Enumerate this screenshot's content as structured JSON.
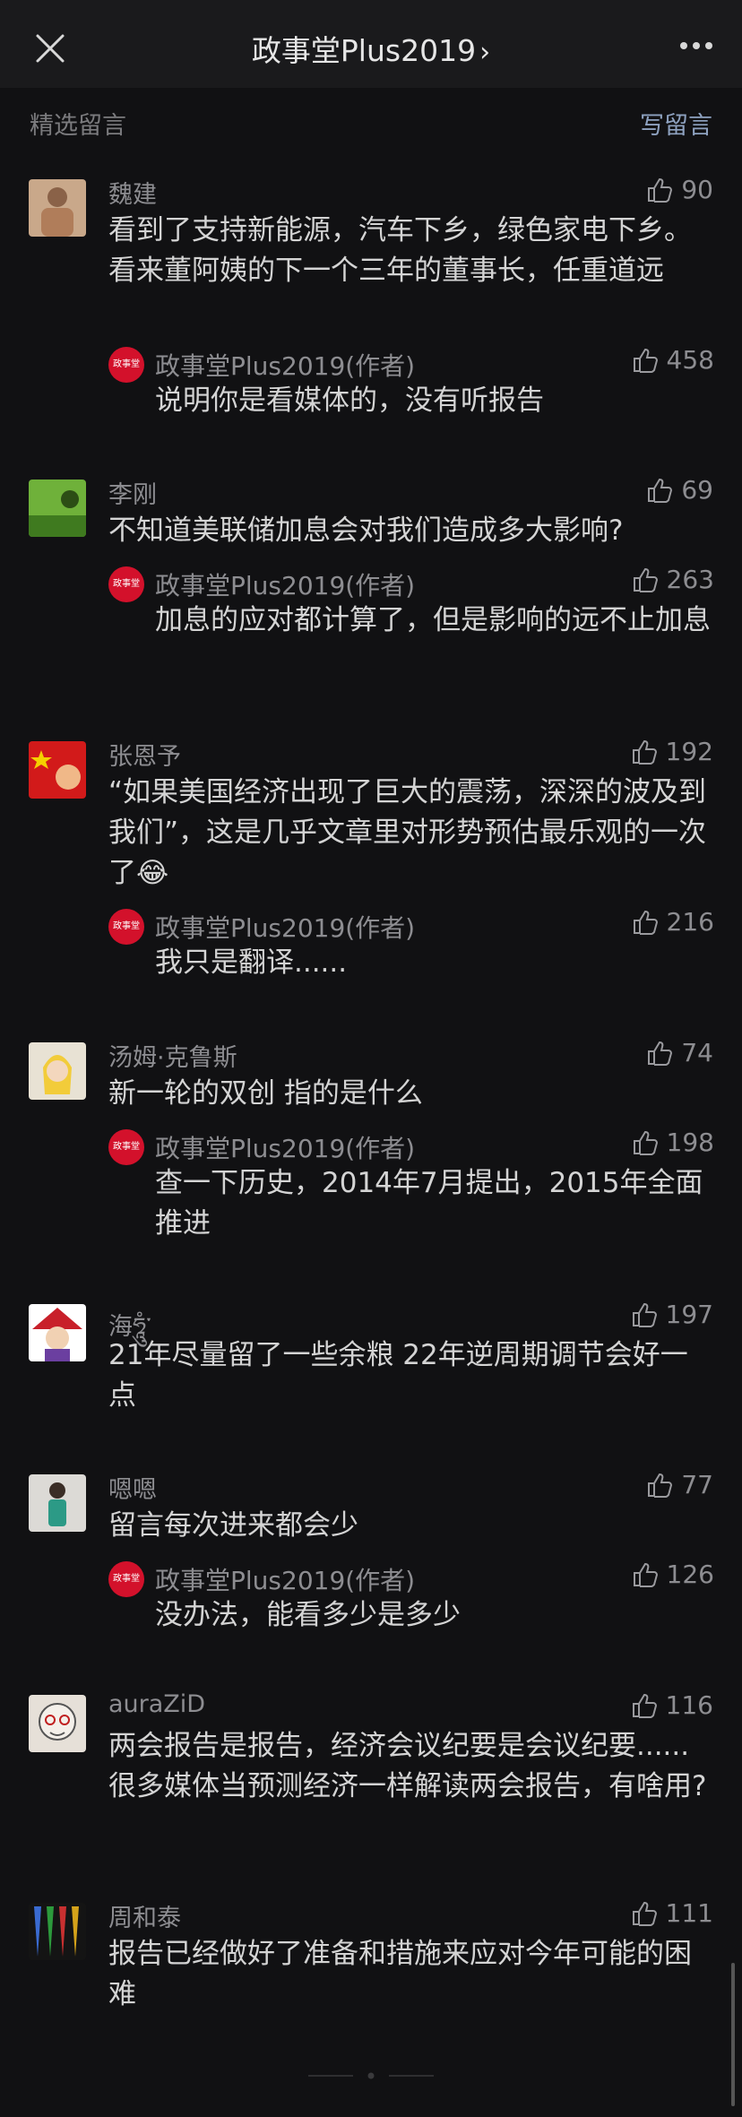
{
  "header": {
    "title": "政事堂Plus2019",
    "chevron": "›",
    "close_icon": "close-icon",
    "more_icon": "more-icon"
  },
  "section": {
    "title": "精选留言",
    "write_label": "写留言"
  },
  "colors": {
    "background": "#111113",
    "topbar": "#1a1a1c",
    "accent_link": "#8ea2c0",
    "author_badge": "#d3112b"
  },
  "comments": [
    {
      "nickname": "魏建",
      "likes": "90",
      "text": "看到了支持新能源，汽车下乡，绿色家电下乡。看来董阿姨的下一个三年的董事长，任重道远",
      "reply": {
        "name": "政事堂Plus2019(作者)",
        "likes": "458",
        "text": "说明你是看媒体的，没有听报告"
      }
    },
    {
      "nickname": "李刚",
      "likes": "69",
      "text": "不知道美联储加息会对我们造成多大影响?",
      "reply": {
        "name": "政事堂Plus2019(作者)",
        "likes": "263",
        "text": "加息的应对都计算了，但是影响的远不止加息"
      }
    },
    {
      "nickname": "张恩予",
      "likes": "192",
      "text": "“如果美国经济出现了巨大的震荡，深深的波及到我们”，这是几乎文章里对形势预估最乐观的一次了😂",
      "reply": {
        "name": "政事堂Plus2019(作者)",
        "likes": "216",
        "text": "我只是翻译......"
      }
    },
    {
      "nickname": "汤姆·克鲁斯",
      "likes": "74",
      "text": "新一轮的双创 指的是什么",
      "reply": {
        "name": "政事堂Plus2019(作者)",
        "likes": "198",
        "text": "查一下历史，2014年7月提出，2015年全面推进"
      }
    },
    {
      "nickname": "海ཧཱུཾ་",
      "likes": "197",
      "text": "21年尽量留了一些余粮 22年逆周期调节会好一点",
      "reply": null
    },
    {
      "nickname": "嗯嗯",
      "likes": "77",
      "text": "留言每次进来都会少",
      "reply": {
        "name": "政事堂Plus2019(作者)",
        "likes": "126",
        "text": "没办法，能看多少是多少"
      }
    },
    {
      "nickname": "auraZiD",
      "likes": "116",
      "text": "两会报告是报告，经济会议纪要是会议纪要......很多媒体当预测经济一样解读两会报告，有啥用?",
      "reply": null
    },
    {
      "nickname": "周和泰",
      "likes": "111",
      "text": "报告已经做好了准备和措施来应对今年可能的困难",
      "reply": null
    }
  ],
  "author_badge_text": "政事堂"
}
